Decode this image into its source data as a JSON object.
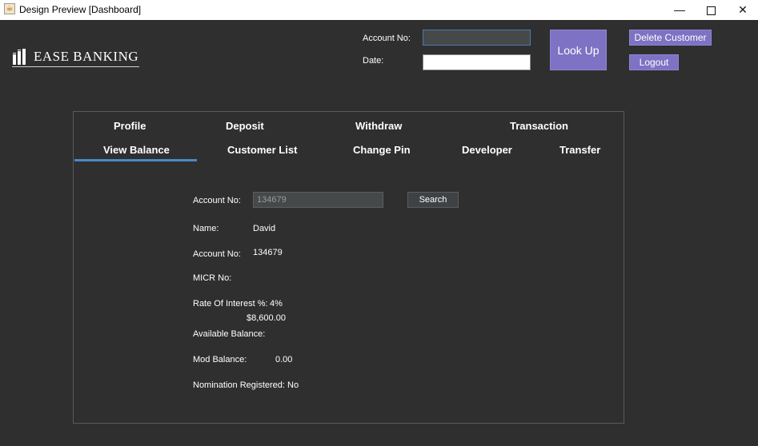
{
  "window": {
    "title": "Design Preview [Dashboard]",
    "minimize": "—",
    "close": "✕"
  },
  "logo": {
    "text": "EASE BANKING"
  },
  "header": {
    "account_label": "Account No:",
    "account_value": "",
    "date_label": "Date:",
    "date_value": "",
    "lookup_label": "Look Up",
    "delete_label": "Delete Customer",
    "logout_label": "Logout"
  },
  "tabs": {
    "profile": "Profile",
    "deposit": "Deposit",
    "withdraw": "Withdraw",
    "transaction": "Transaction",
    "view_balance": "View Balance",
    "customer_list": "Customer List",
    "change_pin": "Change Pin",
    "developer": "Developer",
    "transfer": "Transfer",
    "active": "View Balance"
  },
  "balance": {
    "account_label": "Account No:",
    "account_input": "134679",
    "search_label": "Search",
    "name_label": "Name:",
    "name_value": "David",
    "account_no_label": "Account No:",
    "account_no_value": "134679",
    "micr_label": "MICR No:",
    "micr_value": "",
    "interest_label": "Rate Of Interest %:",
    "interest_value": "4%",
    "available_value": "$8,600.00",
    "available_label": "Available Balance:",
    "mod_label": "Mod Balance:",
    "mod_value": "0.00",
    "nomination_label": "Nomination Registered:",
    "nomination_value": "No"
  },
  "colors": {
    "background": "#2f2f2f",
    "accent_purple": "#7d72c3",
    "tab_underline": "#4a88c7"
  }
}
